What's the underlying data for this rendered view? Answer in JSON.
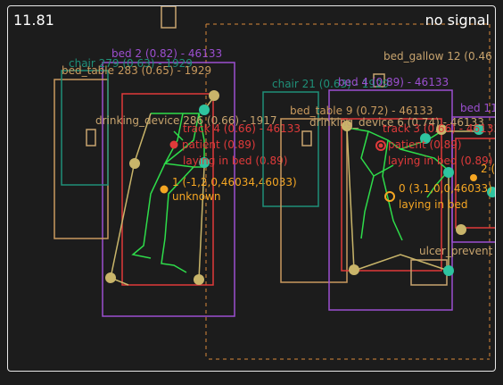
{
  "hud": {
    "frame_time": "11.81",
    "signal_status": "no signal"
  },
  "colors": {
    "bed": "#9b4fd0",
    "bed_table": "#c99a5e",
    "chair": "#1f8f78",
    "drinking_device": "#c8a46e",
    "track": "#e03a3a",
    "patient": "#e03a3a",
    "skeleton": "#2edc4a",
    "joint_teal": "#2ec4a0",
    "joint_tan": "#c9b56a",
    "marker": "#f5a623",
    "room_zone": "#d9893a"
  },
  "labels": {
    "bed_2": "bed 2 (0.82) - 46133",
    "bed_table_283": "bed_table 283 (0.65) - 1929",
    "chair_279": "chair 279 (0.63) - 1929",
    "drinking_device_286": "drinking_device 286 (0.66) - 1917",
    "track_4": "track 4 (0.66) - 46133",
    "patient_left": "patient (0.89)",
    "laying_left": "laying in bed (0.89)",
    "marker_left_id": "1 (-1,2,0,46034,46033)",
    "marker_left_state": "unknown",
    "chair_21": "chair 21 (0.63) - 1929",
    "bed_4": "bed 4 (0.89) - 46133",
    "bed_gallow_12": "bed_gallow 12 (0.46",
    "bed_table_9": "bed_table 9 (0.72) - 46133",
    "drinking_device_6": "drinking_device 6 (0.74) - 46133",
    "track_3": "track 3 (0.66) - 46133",
    "patient_right": "patient (0.89)",
    "laying_right": "laying in bed (0.89)",
    "marker_right_id": "0 (3,1,0,0,46033)",
    "marker_right_state": "laying in bed",
    "bed_11": "bed 11",
    "ulcer_prevention": "ulcer_prevent",
    "extra_marker": "2 ("
  }
}
